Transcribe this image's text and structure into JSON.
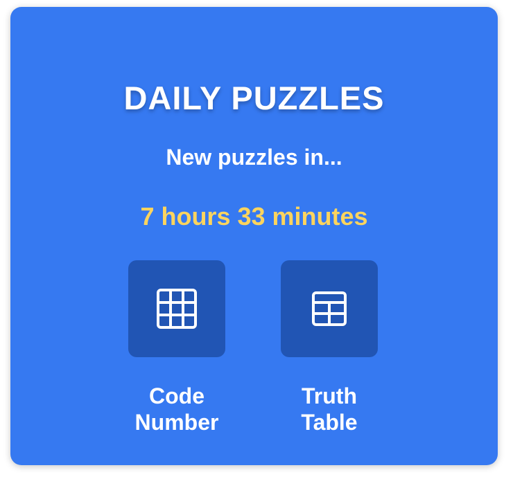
{
  "card": {
    "title": "DAILY PUZZLES",
    "subtitle": "New puzzles in...",
    "countdown": "7 hours 33 minutes"
  },
  "puzzles": [
    {
      "icon": "grid-3x3-icon",
      "label_line1": "Code",
      "label_line2": "Number"
    },
    {
      "icon": "grid-2x2-icon",
      "label_line1": "Truth",
      "label_line2": "Table"
    }
  ],
  "colors": {
    "card_bg": "#3679f1",
    "tile_bg": "#2155b4",
    "countdown": "#fcd45e",
    "text": "#ffffff"
  }
}
